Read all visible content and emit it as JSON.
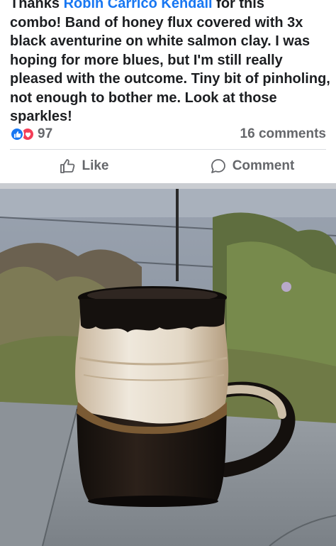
{
  "post": {
    "text_line1_prefix": "Thanks ",
    "mention": "Robin Carrico Kendall",
    "text_line1_suffix": " for this",
    "text_body": "combo! Band of honey flux covered with 3x black aventurine on white salmon clay. I was hoping for more blues, but I'm still really pleased with the outcome. Tiny bit of pinholing, not  enough to bother me. Look at those sparkles!"
  },
  "reactions": {
    "count": "97",
    "icons": [
      "like-icon",
      "love-icon"
    ],
    "comments": "16 comments"
  },
  "actions": {
    "like_label": "Like",
    "comment_label": "Comment"
  },
  "colors": {
    "brand_blue": "#1877f2",
    "love_red": "#f33e58",
    "secondary_text": "#65676b"
  }
}
